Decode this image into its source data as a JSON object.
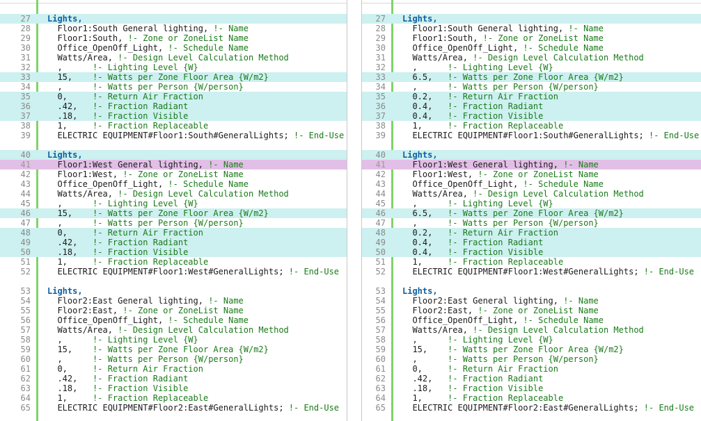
{
  "left_pane": {
    "lines": [
      {
        "num": "27",
        "code": "Lights,",
        "comment": "",
        "kind": "keyword",
        "state": "changed"
      },
      {
        "num": "28",
        "code": "  Floor1:South General lighting,",
        "comment": " !- Name",
        "kind": "field",
        "state": "plain"
      },
      {
        "num": "29",
        "code": "  Floor1:South,",
        "comment": " !- Zone or ZoneList Name",
        "kind": "field",
        "state": "plain"
      },
      {
        "num": "30",
        "code": "  Office_OpenOff_Light,",
        "comment": " !- Schedule Name",
        "kind": "field",
        "state": "plain"
      },
      {
        "num": "31",
        "code": "  Watts/Area,",
        "comment": " !- Design Level Calculation Method",
        "kind": "field",
        "state": "plain"
      },
      {
        "num": "32",
        "code": "  ,",
        "comment": "      !- Lighting Level {W}",
        "kind": "field",
        "state": "plain"
      },
      {
        "num": "33",
        "code": "  15,",
        "comment": "    !- Watts per Zone Floor Area {W/m2}",
        "kind": "field",
        "state": "changed"
      },
      {
        "num": "34",
        "code": "  ,",
        "comment": "      !- Watts per Person {W/person}",
        "kind": "field",
        "state": "plain"
      },
      {
        "num": "35",
        "code": "  0,",
        "comment": "     !- Return Air Fraction",
        "kind": "field",
        "state": "changed"
      },
      {
        "num": "36",
        "code": "  .42,",
        "comment": "   !- Fraction Radiant",
        "kind": "field",
        "state": "changed"
      },
      {
        "num": "37",
        "code": "  .18,",
        "comment": "   !- Fraction Visible",
        "kind": "field",
        "state": "changed"
      },
      {
        "num": "38",
        "code": "  1,",
        "comment": "     !- Fraction Replaceable",
        "kind": "field",
        "state": "plain"
      },
      {
        "num": "39",
        "code": "  ELECTRIC EQUIPMENT#Floor1:South#GeneralLights;",
        "comment": " !- End-Use",
        "kind": "field",
        "state": "plain"
      },
      {
        "num": "40",
        "code": "Lights,",
        "comment": "",
        "kind": "keyword",
        "state": "changed"
      },
      {
        "num": "41",
        "code": "  Floor1:West General lighting,",
        "comment": " !- Name",
        "kind": "field",
        "state": "selected"
      },
      {
        "num": "42",
        "code": "  Floor1:West,",
        "comment": " !- Zone or ZoneList Name",
        "kind": "field",
        "state": "plain"
      },
      {
        "num": "43",
        "code": "  Office_OpenOff_Light,",
        "comment": " !- Schedule Name",
        "kind": "field",
        "state": "plain"
      },
      {
        "num": "44",
        "code": "  Watts/Area,",
        "comment": " !- Design Level Calculation Method",
        "kind": "field",
        "state": "plain"
      },
      {
        "num": "45",
        "code": "  ,",
        "comment": "      !- Lighting Level {W}",
        "kind": "field",
        "state": "plain"
      },
      {
        "num": "46",
        "code": "  15,",
        "comment": "    !- Watts per Zone Floor Area {W/m2}",
        "kind": "field",
        "state": "changed"
      },
      {
        "num": "47",
        "code": "  ,",
        "comment": "      !- Watts per Person {W/person}",
        "kind": "field",
        "state": "plain"
      },
      {
        "num": "48",
        "code": "  0,",
        "comment": "     !- Return Air Fraction",
        "kind": "field",
        "state": "changed"
      },
      {
        "num": "49",
        "code": "  .42,",
        "comment": "   !- Fraction Radiant",
        "kind": "field",
        "state": "changed"
      },
      {
        "num": "50",
        "code": "  .18,",
        "comment": "   !- Fraction Visible",
        "kind": "field",
        "state": "changed"
      },
      {
        "num": "51",
        "code": "  1,",
        "comment": "     !- Fraction Replaceable",
        "kind": "field",
        "state": "plain"
      },
      {
        "num": "52",
        "code": "  ELECTRIC EQUIPMENT#Floor1:West#GeneralLights;",
        "comment": " !- End-Use",
        "kind": "field",
        "state": "plain"
      },
      {
        "num": "53",
        "code": "Lights,",
        "comment": "",
        "kind": "keyword",
        "state": "plain"
      },
      {
        "num": "54",
        "code": "  Floor2:East General lighting,",
        "comment": " !- Name",
        "kind": "field",
        "state": "plain"
      },
      {
        "num": "55",
        "code": "  Floor2:East,",
        "comment": " !- Zone or ZoneList Name",
        "kind": "field",
        "state": "plain"
      },
      {
        "num": "56",
        "code": "  Office_OpenOff_Light,",
        "comment": " !- Schedule Name",
        "kind": "field",
        "state": "plain"
      },
      {
        "num": "57",
        "code": "  Watts/Area,",
        "comment": " !- Design Level Calculation Method",
        "kind": "field",
        "state": "plain"
      },
      {
        "num": "58",
        "code": "  ,",
        "comment": "      !- Lighting Level {W}",
        "kind": "field",
        "state": "plain"
      },
      {
        "num": "59",
        "code": "  15,",
        "comment": "    !- Watts per Zone Floor Area {W/m2}",
        "kind": "field",
        "state": "plain"
      },
      {
        "num": "60",
        "code": "  ,",
        "comment": "      !- Watts per Person {W/person}",
        "kind": "field",
        "state": "plain"
      },
      {
        "num": "61",
        "code": "  0,",
        "comment": "     !- Return Air Fraction",
        "kind": "field",
        "state": "plain"
      },
      {
        "num": "62",
        "code": "  .42,",
        "comment": "   !- Fraction Radiant",
        "kind": "field",
        "state": "plain"
      },
      {
        "num": "63",
        "code": "  .18,",
        "comment": "   !- Fraction Visible",
        "kind": "field",
        "state": "plain"
      },
      {
        "num": "64",
        "code": "  1,",
        "comment": "     !- Fraction Replaceable",
        "kind": "field",
        "state": "plain"
      },
      {
        "num": "65",
        "code": "  ELECTRIC EQUIPMENT#Floor2:East#GeneralLights;",
        "comment": " !- End-Use",
        "kind": "field",
        "state": "plain"
      }
    ]
  },
  "right_pane": {
    "lines": [
      {
        "num": "27",
        "code": "Lights,",
        "comment": "",
        "kind": "keyword",
        "state": "changed"
      },
      {
        "num": "28",
        "code": "  Floor1:South General lighting,",
        "comment": " !- Name",
        "kind": "field",
        "state": "plain"
      },
      {
        "num": "29",
        "code": "  Floor1:South,",
        "comment": " !- Zone or ZoneList Name",
        "kind": "field",
        "state": "plain"
      },
      {
        "num": "30",
        "code": "  Office_OpenOff_Light,",
        "comment": " !- Schedule Name",
        "kind": "field",
        "state": "plain"
      },
      {
        "num": "31",
        "code": "  Watts/Area,",
        "comment": " !- Design Level Calculation Method",
        "kind": "field",
        "state": "plain"
      },
      {
        "num": "32",
        "code": "  ,",
        "comment": "      !- Lighting Level {W}",
        "kind": "field",
        "state": "plain"
      },
      {
        "num": "33",
        "code": "  6.5,",
        "comment": "   !- Watts per Zone Floor Area {W/m2}",
        "kind": "field",
        "state": "changed"
      },
      {
        "num": "34",
        "code": "  ,",
        "comment": "      !- Watts per Person {W/person}",
        "kind": "field",
        "state": "plain"
      },
      {
        "num": "35",
        "code": "  0.2,",
        "comment": "   !- Return Air Fraction",
        "kind": "field",
        "state": "changed"
      },
      {
        "num": "36",
        "code": "  0.4,",
        "comment": "   !- Fraction Radiant",
        "kind": "field",
        "state": "changed"
      },
      {
        "num": "37",
        "code": "  0.4,",
        "comment": "   !- Fraction Visible",
        "kind": "field",
        "state": "changed"
      },
      {
        "num": "38",
        "code": "  1,",
        "comment": "     !- Fraction Replaceable",
        "kind": "field",
        "state": "plain"
      },
      {
        "num": "39",
        "code": "  ELECTRIC EQUIPMENT#Floor1:South#GeneralLights;",
        "comment": " !- End-Use",
        "kind": "field",
        "state": "plain"
      },
      {
        "num": "40",
        "code": "Lights,",
        "comment": "",
        "kind": "keyword",
        "state": "changed"
      },
      {
        "num": "41",
        "code": "  Floor1:West General lighting,",
        "comment": " !- Name",
        "kind": "field",
        "state": "selected"
      },
      {
        "num": "42",
        "code": "  Floor1:West,",
        "comment": " !- Zone or ZoneList Name",
        "kind": "field",
        "state": "plain"
      },
      {
        "num": "43",
        "code": "  Office_OpenOff_Light,",
        "comment": " !- Schedule Name",
        "kind": "field",
        "state": "plain"
      },
      {
        "num": "44",
        "code": "  Watts/Area,",
        "comment": " !- Design Level Calculation Method",
        "kind": "field",
        "state": "plain"
      },
      {
        "num": "45",
        "code": "  ,",
        "comment": "      !- Lighting Level {W}",
        "kind": "field",
        "state": "plain"
      },
      {
        "num": "46",
        "code": "  6.5,",
        "comment": "   !- Watts per Zone Floor Area {W/m2}",
        "kind": "field",
        "state": "changed"
      },
      {
        "num": "47",
        "code": "  ,",
        "comment": "      !- Watts per Person {W/person}",
        "kind": "field",
        "state": "plain"
      },
      {
        "num": "48",
        "code": "  0.2,",
        "comment": "   !- Return Air Fraction",
        "kind": "field",
        "state": "changed"
      },
      {
        "num": "49",
        "code": "  0.4,",
        "comment": "   !- Fraction Radiant",
        "kind": "field",
        "state": "changed"
      },
      {
        "num": "50",
        "code": "  0.4,",
        "comment": "   !- Fraction Visible",
        "kind": "field",
        "state": "changed"
      },
      {
        "num": "51",
        "code": "  1,",
        "comment": "     !- Fraction Replaceable",
        "kind": "field",
        "state": "plain"
      },
      {
        "num": "52",
        "code": "  ELECTRIC EQUIPMENT#Floor1:West#GeneralLights;",
        "comment": " !- End-Use",
        "kind": "field",
        "state": "plain"
      },
      {
        "num": "53",
        "code": "Lights,",
        "comment": "",
        "kind": "keyword",
        "state": "plain"
      },
      {
        "num": "54",
        "code": "  Floor2:East General lighting,",
        "comment": " !- Name",
        "kind": "field",
        "state": "plain"
      },
      {
        "num": "55",
        "code": "  Floor2:East,",
        "comment": " !- Zone or ZoneList Name",
        "kind": "field",
        "state": "plain"
      },
      {
        "num": "56",
        "code": "  Office_OpenOff_Light,",
        "comment": " !- Schedule Name",
        "kind": "field",
        "state": "plain"
      },
      {
        "num": "57",
        "code": "  Watts/Area,",
        "comment": " !- Design Level Calculation Method",
        "kind": "field",
        "state": "plain"
      },
      {
        "num": "58",
        "code": "  ,",
        "comment": "      !- Lighting Level {W}",
        "kind": "field",
        "state": "plain"
      },
      {
        "num": "59",
        "code": "  15,",
        "comment": "    !- Watts per Zone Floor Area {W/m2}",
        "kind": "field",
        "state": "plain"
      },
      {
        "num": "60",
        "code": "  ,",
        "comment": "      !- Watts per Person {W/person}",
        "kind": "field",
        "state": "plain"
      },
      {
        "num": "61",
        "code": "  0,",
        "comment": "     !- Return Air Fraction",
        "kind": "field",
        "state": "plain"
      },
      {
        "num": "62",
        "code": "  .42,",
        "comment": "   !- Fraction Radiant",
        "kind": "field",
        "state": "plain"
      },
      {
        "num": "63",
        "code": "  .18,",
        "comment": "   !- Fraction Visible",
        "kind": "field",
        "state": "plain"
      },
      {
        "num": "64",
        "code": "  1,",
        "comment": "     !- Fraction Replaceable",
        "kind": "field",
        "state": "plain"
      },
      {
        "num": "65",
        "code": "  ELECTRIC EQUIPMENT#Floor2:East#GeneralLights;",
        "comment": " !- End-Use",
        "kind": "field",
        "state": "plain"
      }
    ]
  },
  "colors": {
    "changed_bg": "#cdf0f0",
    "selected_bg": "#e2bfe6",
    "gutter_bar": "#7fd46a",
    "keyword": "#1060a0",
    "comment": "#1a7a1a"
  }
}
